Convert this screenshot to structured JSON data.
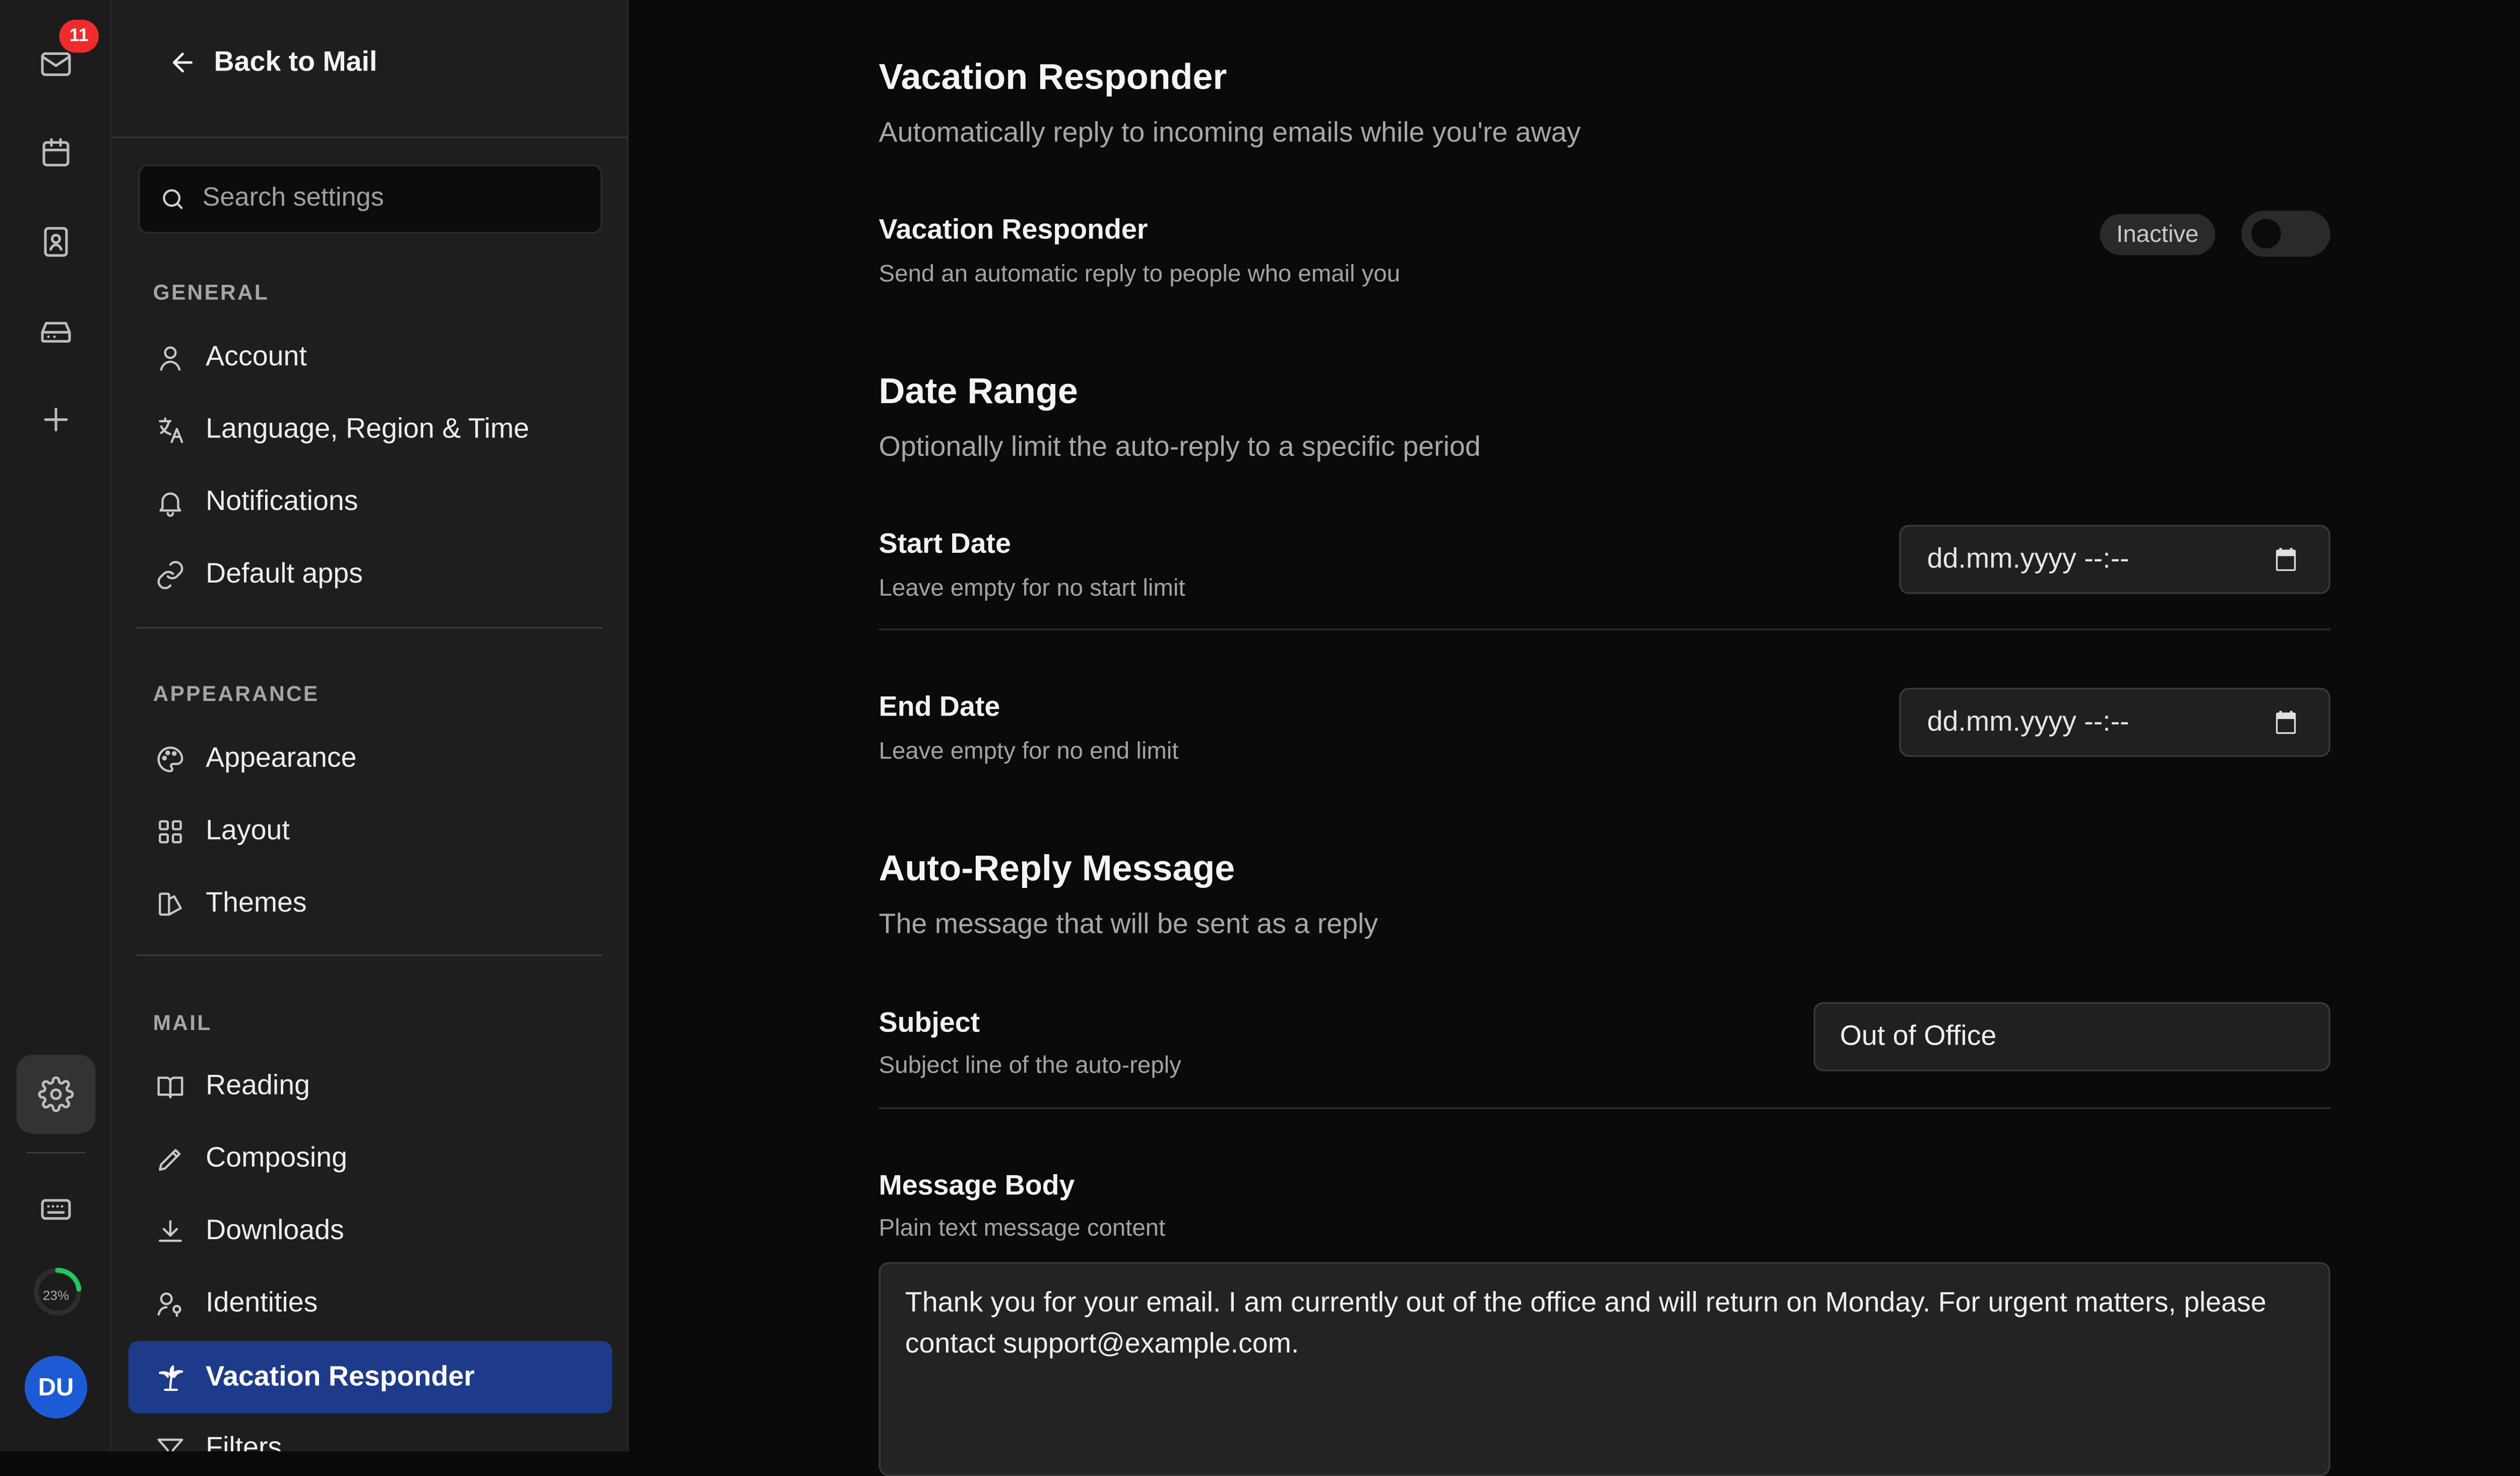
{
  "rail": {
    "mail_badge": "11",
    "progress_label": "23%",
    "progress_fraction": 0.23,
    "avatar_initials": "DU",
    "icons": [
      "mail-icon",
      "calendar-icon",
      "contacts-icon",
      "inbox-icon",
      "plus-icon",
      "gear-icon",
      "keyboard-icon"
    ]
  },
  "sidebar": {
    "back_label": "Back to Mail",
    "search_placeholder": "Search settings",
    "sections": [
      {
        "title": "GENERAL",
        "items": [
          "Account",
          "Language, Region & Time",
          "Notifications",
          "Default apps"
        ]
      },
      {
        "title": "APPEARANCE",
        "items": [
          "Appearance",
          "Layout",
          "Themes"
        ]
      },
      {
        "title": "MAIL",
        "items": [
          "Reading",
          "Composing",
          "Downloads",
          "Identities",
          "Vacation Responder",
          "Filters"
        ]
      }
    ],
    "active_item": "Vacation Responder"
  },
  "main": {
    "vacation": {
      "title": "Vacation Responder",
      "subtitle": "Automatically reply to incoming emails while you're away",
      "toggle_label": "Vacation Responder",
      "toggle_desc": "Send an automatic reply to people who email you",
      "status": "Inactive",
      "enabled": false
    },
    "date_range": {
      "title": "Date Range",
      "subtitle": "Optionally limit the auto-reply to a specific period",
      "start_label": "Start Date",
      "start_desc": "Leave empty for no start limit",
      "start_value": "dd.mm.yyyy --:--",
      "end_label": "End Date",
      "end_desc": "Leave empty for no end limit",
      "end_value": "dd.mm.yyyy --:--"
    },
    "message": {
      "title": "Auto-Reply Message",
      "subtitle": "The message that will be sent as a reply",
      "subject_label": "Subject",
      "subject_desc": "Subject line of the auto-reply",
      "subject_value": "Out of Office",
      "body_label": "Message Body",
      "body_desc": "Plain text message content",
      "body_value": "Thank you for your email. I am currently out of the office and will return on Monday. For urgent matters, please contact support@example.com."
    }
  },
  "colors": {
    "accent": "#1e3a8a",
    "badge": "#ef2b2b",
    "avatar": "#1d5bd6",
    "progress": "#22c55e"
  }
}
